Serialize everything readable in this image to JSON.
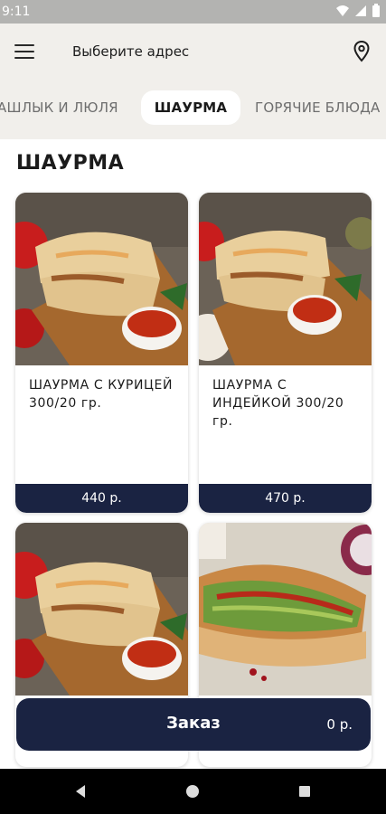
{
  "status_bar": {
    "time": "9:11"
  },
  "header": {
    "address_label": "Выберите адрес"
  },
  "categories": [
    {
      "label": "АШЛЫК И ЛЮЛЯ"
    },
    {
      "label": "ШАУРМА"
    },
    {
      "label": "ГОРЯЧИЕ БЛЮДА"
    }
  ],
  "section": {
    "title": "ШАУРМА"
  },
  "products": [
    {
      "name": "ШАУРМА С КУРИЦЕЙ  300/20 гр.",
      "price": "440 р."
    },
    {
      "name": "ШАУРМА С ИНДЕЙКОЙ  300/20 гр.",
      "price": "470 р."
    },
    {
      "name": "",
      "price": ""
    },
    {
      "name": "",
      "price": ""
    }
  ],
  "order": {
    "label": "Заказ",
    "total": "0 р."
  },
  "colors": {
    "accent": "#1a2342",
    "header_bg": "#f1efeb",
    "status_bar": "#b3b3b1"
  }
}
